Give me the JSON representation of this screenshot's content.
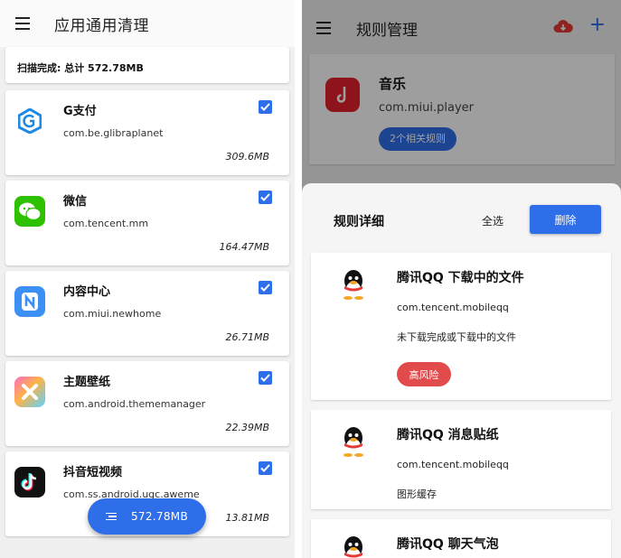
{
  "left": {
    "title": "应用通用清理",
    "summary": "扫描完成: 总计 572.78MB",
    "apps": [
      {
        "name": "G支付",
        "package": "com.be.glibraplanet",
        "size": "309.6MB",
        "icon": "gpay-icon"
      },
      {
        "name": "微信",
        "package": "com.tencent.mm",
        "size": "164.47MB",
        "icon": "wechat-icon"
      },
      {
        "name": "内容中心",
        "package": "com.miui.newhome",
        "size": "26.71MB",
        "icon": "content-center-icon"
      },
      {
        "name": "主题壁纸",
        "package": "com.android.thememanager",
        "size": "22.39MB",
        "icon": "theme-icon"
      },
      {
        "name": "抖音短视频",
        "package": "com.ss.android.ugc.aweme",
        "size": "13.81MB",
        "icon": "douyin-icon"
      }
    ],
    "fab_label": "572.78MB"
  },
  "right": {
    "title": "规则管理",
    "music": {
      "name": "音乐",
      "package": "com.miui.player",
      "rules_chip": "2个相关规则"
    },
    "sheet": {
      "title": "规则详细",
      "select_all": "全选",
      "delete": "删除",
      "rules": [
        {
          "name": "腾讯QQ 下载中的文件",
          "package": "com.tencent.mobileqq",
          "desc": "未下载完成或下载中的文件",
          "badge": "高风险"
        },
        {
          "name": "腾讯QQ 消息贴纸",
          "package": "com.tencent.mobileqq",
          "desc": "图形缓存"
        },
        {
          "name": "腾讯QQ 聊天气泡"
        }
      ]
    }
  },
  "colors": {
    "accent": "#2f6ee9",
    "danger": "#e14b4b",
    "music": "#e6212c"
  }
}
